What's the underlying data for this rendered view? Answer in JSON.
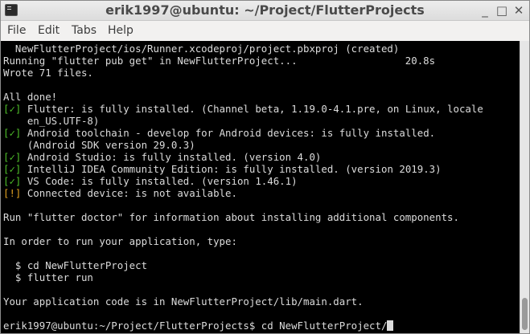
{
  "window": {
    "title": "erik1997@ubuntu: ~/Project/FlutterProjects",
    "minimize_glyph": "_",
    "maximize_glyph": "□",
    "close_glyph": "✕"
  },
  "menubar": {
    "items": [
      "File",
      "Edit",
      "Tabs",
      "Help"
    ]
  },
  "terminal": {
    "lines": [
      {
        "text": "  NewFlutterProject/ios/Runner.xcodeproj/project.pbxproj (created)"
      },
      {
        "text": "Running \"flutter pub get\" in NewFlutterProject...                  20.8s"
      },
      {
        "text": "Wrote 71 files."
      },
      {
        "text": ""
      },
      {
        "text": "All done!"
      },
      {
        "mark": "[✓]",
        "status": "ok",
        "text": " Flutter: is fully installed. (Channel beta, 1.19.0-4.1.pre, on Linux, locale"
      },
      {
        "text": "    en_US.UTF-8)"
      },
      {
        "mark": "[✓]",
        "status": "ok",
        "text": " Android toolchain - develop for Android devices: is fully installed."
      },
      {
        "text": "    (Android SDK version 29.0.3)"
      },
      {
        "mark": "[✓]",
        "status": "ok",
        "text": " Android Studio: is fully installed. (version 4.0)"
      },
      {
        "mark": "[✓]",
        "status": "ok",
        "text": " IntelliJ IDEA Community Edition: is fully installed. (version 2019.3)"
      },
      {
        "mark": "[✓]",
        "status": "ok",
        "text": " VS Code: is fully installed. (version 1.46.1)"
      },
      {
        "mark": "[!]",
        "status": "warn",
        "text": " Connected device: is not available."
      },
      {
        "text": ""
      },
      {
        "text": "Run \"flutter doctor\" for information about installing additional components."
      },
      {
        "text": ""
      },
      {
        "text": "In order to run your application, type:"
      },
      {
        "text": ""
      },
      {
        "text": "  $ cd NewFlutterProject"
      },
      {
        "text": "  $ flutter run"
      },
      {
        "text": ""
      },
      {
        "text": "Your application code is in NewFlutterProject/lib/main.dart."
      },
      {
        "text": ""
      }
    ],
    "prompt": "erik1997@ubuntu:~/Project/FlutterProjects$ ",
    "command": "cd NewFlutterProject/"
  },
  "colors": {
    "terminal_bg": "#000000",
    "terminal_fg": "#dcdcdc",
    "ok_mark": "#4fbf2a",
    "warn_mark": "#e0a020"
  }
}
